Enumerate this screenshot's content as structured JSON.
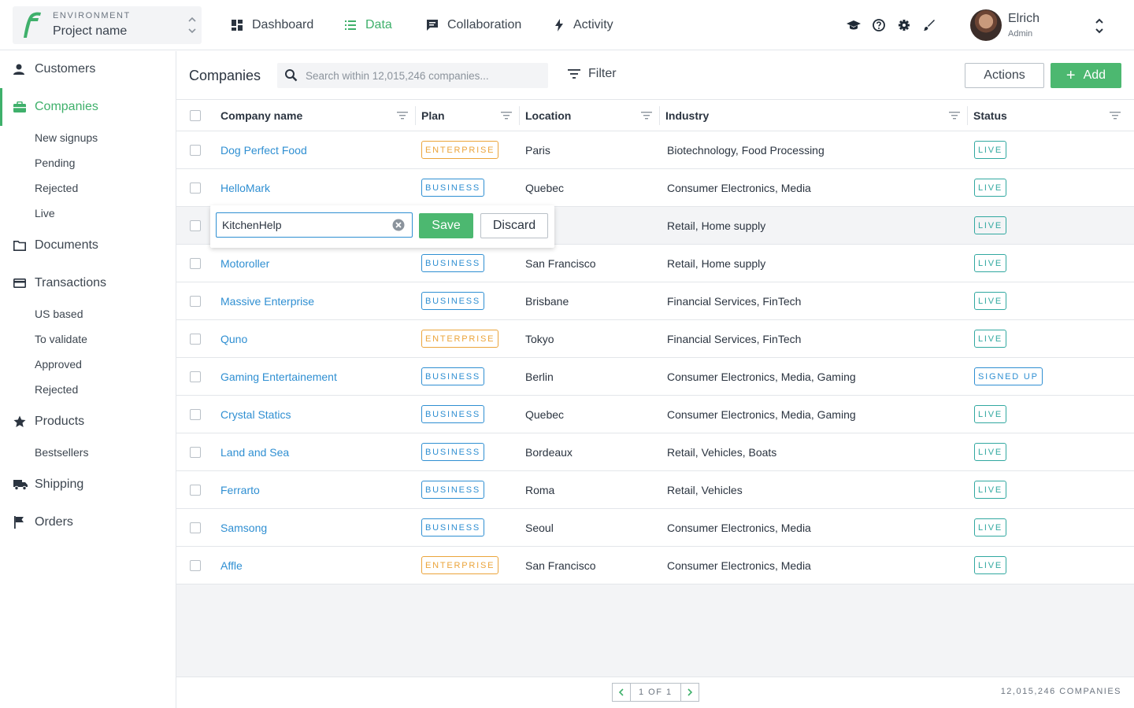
{
  "environment": {
    "label": "ENVIRONMENT",
    "project_name": "Project name"
  },
  "nav": {
    "items": [
      {
        "label": "Dashboard",
        "icon": "dashboard-icon"
      },
      {
        "label": "Data",
        "icon": "list-icon",
        "active": true
      },
      {
        "label": "Collaboration",
        "icon": "chat-icon"
      },
      {
        "label": "Activity",
        "icon": "bolt-icon"
      }
    ]
  },
  "tools": [
    "graduation-cap-icon",
    "help-icon",
    "gear-icon",
    "brush-icon"
  ],
  "user": {
    "name": "Elrich",
    "role": "Admin"
  },
  "sidebar": {
    "customers": "Customers",
    "companies": "Companies",
    "companies_sub": [
      "New signups",
      "Pending",
      "Rejected",
      "Live"
    ],
    "documents": "Documents",
    "transactions": "Transactions",
    "transactions_sub": [
      "US based",
      "To validate",
      "Approved",
      "Rejected"
    ],
    "products": "Products",
    "products_sub": [
      "Bestsellers"
    ],
    "shipping": "Shipping",
    "orders": "Orders"
  },
  "toolbar": {
    "title": "Companies",
    "search_placeholder": "Search within 12,015,246 companies...",
    "filter_label": "Filter",
    "actions_label": "Actions",
    "add_label": "Add"
  },
  "table": {
    "columns": [
      "Company name",
      "Plan",
      "Location",
      "Industry",
      "Status"
    ],
    "rows": [
      {
        "name": "Dog Perfect Food",
        "plan": "ENTERPRISE",
        "location": "Paris",
        "industry": "Biotechnology, Food Processing",
        "status": "LIVE"
      },
      {
        "name": "HelloMark",
        "plan": "BUSINESS",
        "location": "Quebec",
        "industry": "Consumer Electronics, Media",
        "status": "LIVE"
      },
      {
        "name": "KitchenHelp",
        "plan": "",
        "location": "",
        "industry": "Retail, Home supply",
        "status": "LIVE",
        "editing": true
      },
      {
        "name": "Motoroller",
        "plan": "BUSINESS",
        "location": "San Francisco",
        "industry": "Retail, Home supply",
        "status": "LIVE"
      },
      {
        "name": "Massive Enterprise",
        "plan": "BUSINESS",
        "location": "Brisbane",
        "industry": "Financial Services, FinTech",
        "status": "LIVE"
      },
      {
        "name": "Quno",
        "plan": "ENTERPRISE",
        "location": "Tokyo",
        "industry": "Financial Services, FinTech",
        "status": "LIVE"
      },
      {
        "name": "Gaming Entertainement",
        "plan": "BUSINESS",
        "location": "Berlin",
        "industry": "Consumer Electronics, Media, Gaming",
        "status": "SIGNED UP"
      },
      {
        "name": "Crystal Statics",
        "plan": "BUSINESS",
        "location": "Quebec",
        "industry": "Consumer Electronics, Media, Gaming",
        "status": "LIVE"
      },
      {
        "name": "Land and Sea",
        "plan": "BUSINESS",
        "location": "Bordeaux",
        "industry": "Retail, Vehicles, Boats",
        "status": "LIVE"
      },
      {
        "name": "Ferrarto",
        "plan": "BUSINESS",
        "location": "Roma",
        "industry": "Retail, Vehicles",
        "status": "LIVE"
      },
      {
        "name": "Samsong",
        "plan": "BUSINESS",
        "location": "Seoul",
        "industry": "Consumer Electronics, Media",
        "status": "LIVE"
      },
      {
        "name": "Affle",
        "plan": "ENTERPRISE",
        "location": "San Francisco",
        "industry": "Consumer Electronics, Media",
        "status": "LIVE"
      }
    ]
  },
  "editor": {
    "value": "KitchenHelp",
    "save_label": "Save",
    "discard_label": "Discard"
  },
  "footer": {
    "page_label": "1 OF 1",
    "count_label": "12,015,246 COMPANIES"
  },
  "colors": {
    "accent": "#3fb06b",
    "link": "#2f8fd2",
    "enterprise": "#eba43a",
    "live": "#31a8a0"
  }
}
